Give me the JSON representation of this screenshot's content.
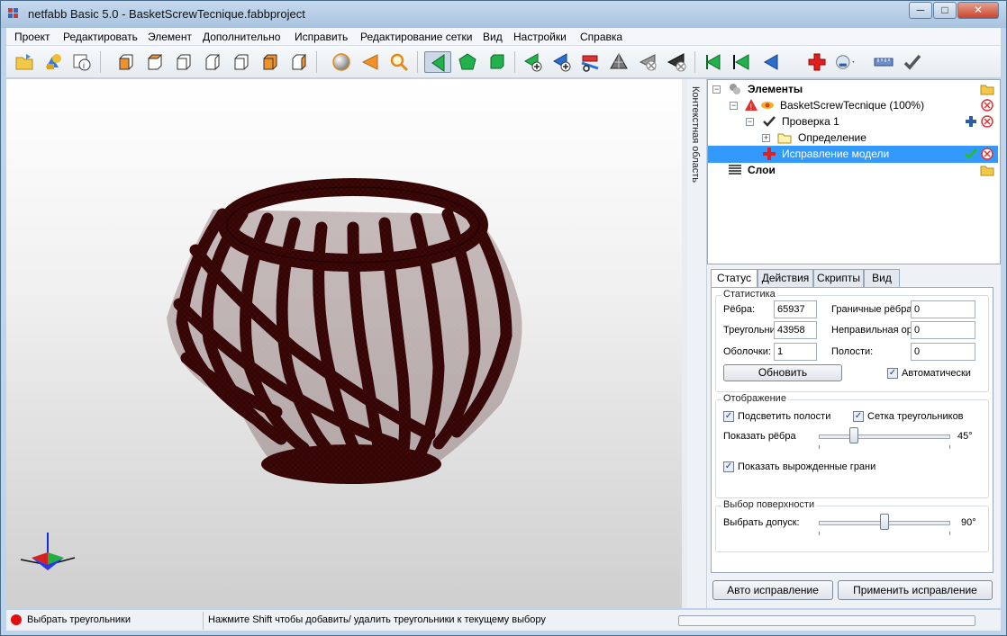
{
  "window": {
    "title": "netfabb Basic 5.0 - BasketScrewTecnique.fabbproject",
    "min_label": "─",
    "max_label": "□",
    "close_label": "✕"
  },
  "menu": [
    "Проект",
    "Редактировать",
    "Элемент",
    "Дополнительно",
    "Исправить",
    "Редактирование сетки",
    "Вид",
    "Настройки",
    "Справка"
  ],
  "toolbar": {
    "icons": [
      "open-project-icon",
      "add-part-icon",
      "part-info-icon",
      "view-front-icon",
      "view-back-icon",
      "view-left-icon",
      "view-right-icon",
      "view-top-icon",
      "view-bottom-icon",
      "view-perspective-icon",
      "sphere-icon",
      "cone-icon",
      "zoom-icon",
      "select-triangles-icon",
      "select-shell-icon",
      "select-surface-icon",
      "add-triangle-icon",
      "add-point-icon",
      "cut-icon",
      "mesh-icon",
      "remove-degenerate-icon",
      "delete-triangle-icon",
      "arrow-left-green-icon",
      "arrow-left-green2-icon",
      "arrow-left-blue-icon",
      "repair-cross-icon",
      "measure-dropdown-icon",
      "ruler-icon",
      "apply-check-icon"
    ]
  },
  "context_tab": {
    "label": "Контекстная область"
  },
  "tree": {
    "items": [
      {
        "label": "Элементы",
        "bold": true
      },
      {
        "label": "BasketScrewTecnique (100%)"
      },
      {
        "label": "Проверка 1"
      },
      {
        "label": "Определение"
      },
      {
        "label": "Исправление модели",
        "selected": true
      },
      {
        "label": "Слои",
        "bold": true
      }
    ]
  },
  "tabs": [
    "Статус",
    "Действия",
    "Скрипты",
    "Вид"
  ],
  "stats": {
    "group_label": "Статистика",
    "edges_label": "Рёбра:",
    "edges_value": "65937",
    "triangles_label": "Треугольни",
    "triangles_value": "43958",
    "shells_label": "Оболочки:",
    "shells_value": "1",
    "border_edges_label": "Граничные рёбра",
    "border_edges_value": "0",
    "wrong_orient_label": "Неправильная ор",
    "wrong_orient_value": "0",
    "holes_label": "Полости:",
    "holes_value": "0",
    "refresh_button": "Обновить",
    "auto_label": "Автоматически",
    "auto_checked": true
  },
  "display": {
    "group_label": "Отображение",
    "highlight_holes_label": "Подсветить полости",
    "triangle_mesh_label": "Сетка треугольников",
    "show_edges_label": "Показать рёбра",
    "show_edges_value": "45°",
    "show_edges_fraction": 0.25,
    "show_degenerate_label": "Показать вырожденные грани"
  },
  "surface": {
    "group_label": "Выбор поверхности",
    "tolerance_label": "Выбрать допуск:",
    "tolerance_value": "90°",
    "tolerance_fraction": 0.5
  },
  "actions": {
    "auto_repair": "Авто исправление",
    "apply_repair": "Применить исправление"
  },
  "status": {
    "mode": "Выбрать треугольники",
    "hint": "Нажмите Shift чтобы добавить/ удалить треугольники к текущему выбору"
  },
  "colors": {
    "model": "#3a0a0a",
    "selection": "#3399ff",
    "accent_green": "#22b14c"
  }
}
